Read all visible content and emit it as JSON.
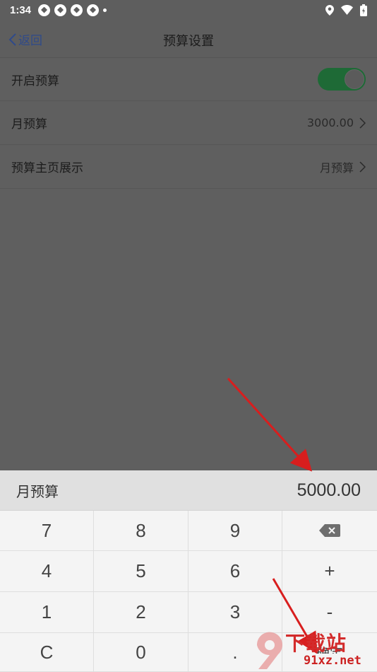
{
  "status_bar": {
    "time": "1:34"
  },
  "nav": {
    "back_label": "返回",
    "title": "预算设置"
  },
  "settings": {
    "enable_label": "开启预算",
    "enable_on": true,
    "monthly_label": "月预算",
    "monthly_value": "3000.00",
    "home_label": "预算主页展示",
    "home_value": "月预算"
  },
  "keypad": {
    "label": "月预算",
    "amount": "5000.00",
    "keys": [
      "7",
      "8",
      "9",
      "backspace",
      "4",
      "5",
      "6",
      "+",
      "1",
      "2",
      "3",
      "-",
      "C",
      "0",
      ".",
      "确定"
    ]
  },
  "watermark": {
    "brand": "下载站",
    "url": "91xz.net"
  },
  "colors": {
    "accent_link": "#2f4a8a",
    "toggle_on": "#1e6a36",
    "arrow": "#d81e1e"
  }
}
